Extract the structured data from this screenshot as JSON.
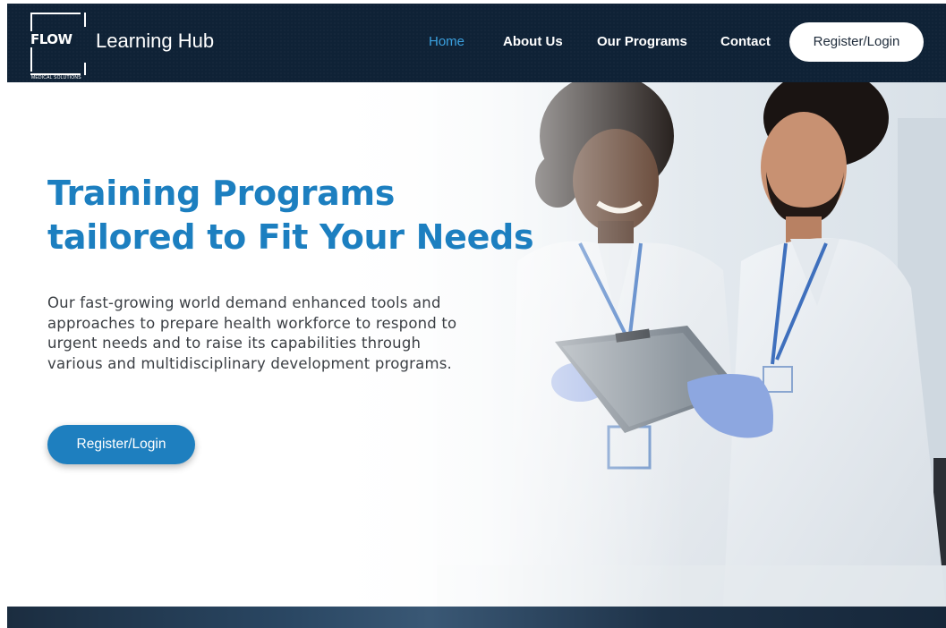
{
  "header": {
    "logo": {
      "word": "FLOW",
      "subtitle": "MEDICAL SOLUTIONS"
    },
    "brand_name": "Learning Hub",
    "nav": [
      {
        "label": "Home",
        "active": true
      },
      {
        "label": "About Us",
        "active": false
      },
      {
        "label": "Our Programs",
        "active": false
      },
      {
        "label": "Contact",
        "active": false
      }
    ],
    "register_label": "Register/Login"
  },
  "hero": {
    "title_lines": [
      "Training Programs",
      "tailored to Fit Your Needs"
    ],
    "description_lines": [
      "Our fast-growing world demand enhanced tools and",
      "approaches to prepare health workforce to respond to",
      "urgent needs and to raise its capabilities through",
      "various and multidisciplinary development programs."
    ],
    "button_label": "Register/Login"
  },
  "colors": {
    "navbar_bg": "#0f2236",
    "accent_blue": "#1e7fbf",
    "active_nav": "#3ba1e0",
    "title_blue": "#1c7fc0",
    "body_text": "#3b3f44"
  },
  "icons": {
    "logo": "flow-logo-icon"
  }
}
